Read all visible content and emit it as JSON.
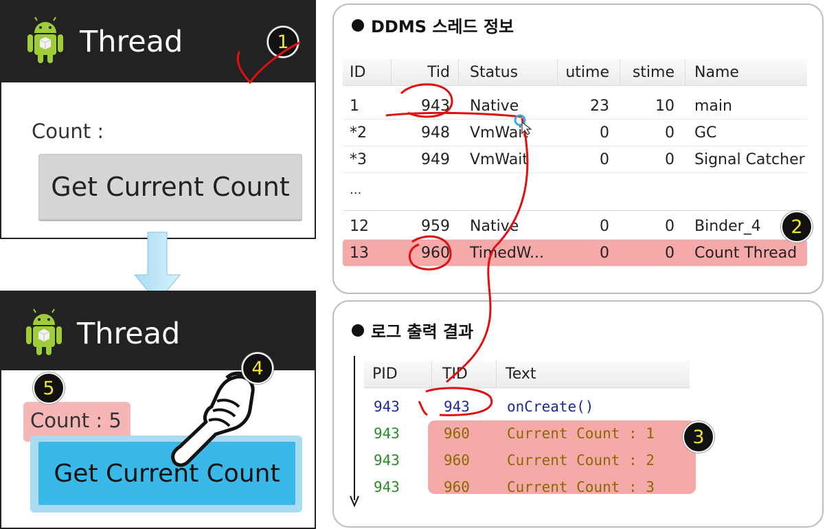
{
  "phone_top": {
    "title": "Thread",
    "count_label": "Count :",
    "button_label": "Get Current Count"
  },
  "phone_bottom": {
    "title": "Thread",
    "count_label": "Count : 5",
    "button_label": "Get Current Count"
  },
  "badges": [
    "1",
    "2",
    "3",
    "4",
    "5"
  ],
  "ddms": {
    "title": "DDMS 스레드 정보",
    "columns": [
      "ID",
      "Tid",
      "Status",
      "utime",
      "stime",
      "Name"
    ],
    "rows": [
      {
        "id": "1",
        "tid": "943",
        "status": "Native",
        "utime": "23",
        "stime": "10",
        "name": "main"
      },
      {
        "id": "*2",
        "tid": "948",
        "status": "VmWait",
        "utime": "0",
        "stime": "0",
        "name": "GC"
      },
      {
        "id": "*3",
        "tid": "949",
        "status": "VmWait",
        "utime": "0",
        "stime": "0",
        "name": "Signal Catcher"
      },
      {
        "id": "...",
        "tid": "",
        "status": "",
        "utime": "",
        "stime": "",
        "name": ""
      },
      {
        "id": "12",
        "tid": "959",
        "status": "Native",
        "utime": "0",
        "stime": "0",
        "name": "Binder_4"
      },
      {
        "id": "13",
        "tid": "960",
        "status": "TimedW...",
        "utime": "0",
        "stime": "0",
        "name": "Count Thread"
      }
    ]
  },
  "log": {
    "title": "로그 출력 결과",
    "columns": [
      "PID",
      "TID",
      "Text"
    ],
    "rows": [
      {
        "pid": "943",
        "tid": "943",
        "text": "onCreate()"
      },
      {
        "pid": "943",
        "tid": "960",
        "text": "Current Count : 1"
      },
      {
        "pid": "943",
        "tid": "960",
        "text": "Current Count : 2"
      },
      {
        "pid": "943",
        "tid": "960",
        "text": "Current Count : 3"
      }
    ]
  },
  "colors": {
    "action_bar": "#222222",
    "highlight": "#f6a9a9",
    "button_blue": "#3ab8e8",
    "badge_text": "#f1e634",
    "annotation": "#e01010",
    "log_info": "#1a2a9a",
    "log_debug": "#2a8a2a",
    "log_debug_text": "#8a6a00"
  }
}
